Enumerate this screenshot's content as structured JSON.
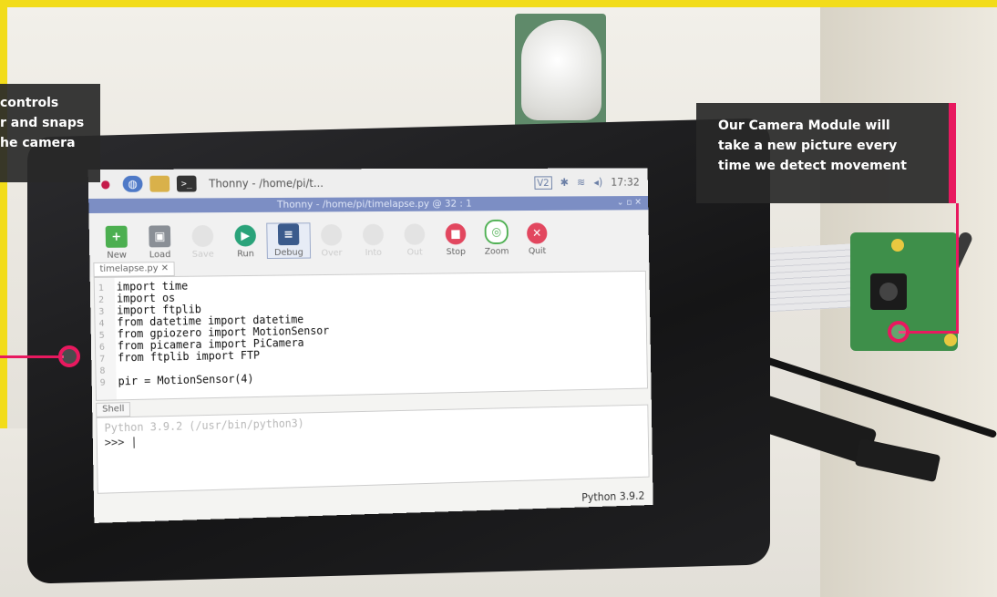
{
  "callouts": {
    "left_lines": [
      "controls",
      "r and snaps",
      "he camera"
    ],
    "right_lines": [
      "Our Camera Module will",
      "take a new picture every",
      "time we detect movement"
    ],
    "accent_color": "#e8195f"
  },
  "taskbar": {
    "app_label": "Thonny - /home/pi/t...",
    "time": "17:32"
  },
  "window": {
    "title": "Thonny - /home/pi/timelapse.py @ 32 : 1"
  },
  "toolbar": {
    "new": "New",
    "load": "Load",
    "save": "Save",
    "run": "Run",
    "debug": "Debug",
    "over": "Over",
    "into": "Into",
    "out": "Out",
    "stop": "Stop",
    "zoom": "Zoom",
    "quit": "Quit"
  },
  "editor": {
    "tab": "timelapse.py ✕",
    "lines": [
      {
        "n": "1",
        "text": "import time"
      },
      {
        "n": "2",
        "text": "import os"
      },
      {
        "n": "3",
        "text": "import ftplib"
      },
      {
        "n": "4",
        "text": "from datetime import datetime"
      },
      {
        "n": "5",
        "text": "from gpiozero import MotionSensor"
      },
      {
        "n": "6",
        "text": "from picamera import PiCamera"
      },
      {
        "n": "7",
        "text": "from ftplib import FTP"
      },
      {
        "n": "8",
        "text": ""
      },
      {
        "n": "9",
        "text": "pir = MotionSensor(4)"
      }
    ]
  },
  "shell": {
    "tab": "Shell",
    "banner": "Python 3.9.2 (/usr/bin/python3)",
    "prompt": ">>> "
  },
  "status": {
    "interpreter": "Python 3.9.2"
  },
  "icons": [
    "raspberry-menu-icon",
    "browser-icon",
    "file-manager-icon",
    "terminal-icon",
    "vnc-icon",
    "bluetooth-icon",
    "wifi-icon",
    "volume-icon"
  ]
}
